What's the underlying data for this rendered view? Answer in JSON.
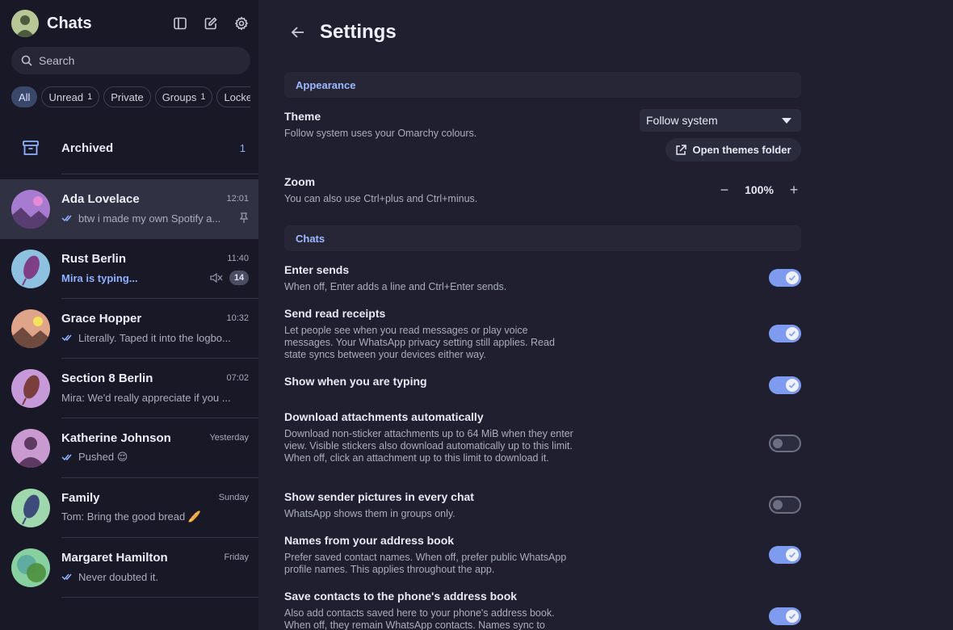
{
  "sidebar": {
    "title": "Chats",
    "search_placeholder": "Search",
    "filters": [
      {
        "label": "All",
        "count": ""
      },
      {
        "label": "Unread",
        "count": "1"
      },
      {
        "label": "Private",
        "count": ""
      },
      {
        "label": "Groups",
        "count": "1"
      },
      {
        "label": "Locke",
        "count": ""
      }
    ],
    "archived": {
      "label": "Archived",
      "count": "1"
    },
    "chats": [
      {
        "name": "Ada Lovelace",
        "time": "12:01",
        "preview": "btw i made my own Spotify a...",
        "read": true,
        "pinned": true
      },
      {
        "name": "Rust Berlin",
        "time": "11:40",
        "preview": "Mira is typing...",
        "typing": true,
        "muted": true,
        "unread": "14"
      },
      {
        "name": "Grace Hopper",
        "time": "10:32",
        "preview": "Literally. Taped it into the logbo...",
        "read": true
      },
      {
        "name": "Section 8 Berlin",
        "time": "07:02",
        "preview": "Mira: We'd really appreciate if you ..."
      },
      {
        "name": "Katherine Johnson",
        "time": "Yesterday",
        "preview": "Pushed 😌",
        "read": true
      },
      {
        "name": "Family",
        "time": "Sunday",
        "preview": "Tom: Bring the good bread 🥖"
      },
      {
        "name": "Margaret Hamilton",
        "time": "Friday",
        "preview": "Never doubted it.",
        "read": true
      }
    ]
  },
  "settings": {
    "title": "Settings",
    "appearance": {
      "section_label": "Appearance",
      "theme_title": "Theme",
      "theme_desc": "Follow system uses your Omarchy colours.",
      "theme_value": "Follow system",
      "themes_folder_label": "Open themes folder",
      "zoom_title": "Zoom",
      "zoom_desc": "You can also use Ctrl+plus and Ctrl+minus.",
      "zoom_value": "100%",
      "zoom_minus": "−",
      "zoom_plus": "+"
    },
    "chats": {
      "section_label": "Chats",
      "options": [
        {
          "title": "Enter sends",
          "desc": "When off, Enter adds a line and Ctrl+Enter sends.",
          "on": true
        },
        {
          "title": "Send read receipts",
          "desc": "Let people see when you read messages or play voice messages. Your WhatsApp privacy setting still applies. Read state syncs between your devices either way.",
          "on": true
        },
        {
          "title": "Show when you are typing",
          "desc": "",
          "on": true
        },
        {
          "title": "Download attachments automatically",
          "desc": "Download non-sticker attachments up to 64 MiB when they enter view. Visible stickers also download automatically up to this limit. When off, click an attachment up to this limit to download it.",
          "on": false
        },
        {
          "title": "Show sender pictures in every chat",
          "desc": "WhatsApp shows them in groups only.",
          "on": false
        },
        {
          "title": "Names from your address book",
          "desc": "Prefer saved contact names. When off, prefer public WhatsApp profile names. This applies throughout the app.",
          "on": true
        },
        {
          "title": "Save contacts to the phone's address book",
          "desc": "Also add contacts saved here to your phone's address book. When off, they remain WhatsApp contacts. Names sync to",
          "on": true
        }
      ]
    }
  },
  "colors": {
    "accent": "#7f9bf0",
    "accent_text": "#8fb1ff",
    "sidebar_bg": "#181827",
    "main_bg": "#1f1f2f"
  }
}
